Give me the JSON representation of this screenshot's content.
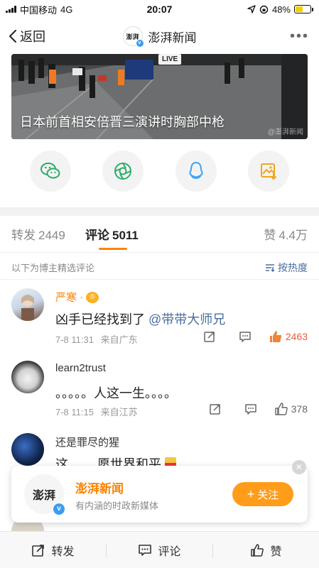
{
  "status": {
    "carrier": "中国移动",
    "network": "4G",
    "time": "20:07",
    "battery": "48%",
    "battery_level": 0.48
  },
  "nav": {
    "back_label": "返回",
    "title": "澎湃新闻",
    "avatar_text": "澎湃"
  },
  "banner": {
    "live_tag": "LIVE",
    "title": "日本前首相安倍晋三演讲时胸部中枪",
    "watermark": "@澎湃新闻"
  },
  "share": {
    "items": [
      {
        "icon": "wechat-icon",
        "color": "#2aae67"
      },
      {
        "icon": "moments-icon",
        "color": "#2aae67"
      },
      {
        "icon": "qq-icon",
        "color": "#3da3f5"
      },
      {
        "icon": "save-image-icon",
        "color": "#f2a516"
      }
    ]
  },
  "tabs": {
    "repost_label": "转发",
    "repost_count": "2449",
    "comment_label": "评论",
    "comment_count": "5011",
    "like_label": "赞",
    "like_count": "4.4万"
  },
  "filter": {
    "note": "以下为博主精选评论",
    "sort_label": "按热度"
  },
  "comments": [
    {
      "name": "严寒",
      "name_suffix": "·",
      "name_color": "#ff8200",
      "text": "凶手已经找到了",
      "mention": "@带带大师兄",
      "time": "7-8 11:31",
      "location": "来自广东",
      "likes": "2463",
      "liked": true
    },
    {
      "name": "learn2trust",
      "name_color": "#333333",
      "text": "。。。。。人这一生。。。。",
      "time": "7-8 11:15",
      "location": "来自江苏",
      "likes": "378",
      "liked": false
    },
    {
      "name": "还是罪尽的猩",
      "name_color": "#333333",
      "text": "这…… 愿世界和平"
    }
  ],
  "follow_card": {
    "name": "澎湃新闻",
    "desc": "有内涵的时政新媒体",
    "button": "关注",
    "avatar_text": "澎湃"
  },
  "bottom": {
    "repost": "转发",
    "comment": "评论",
    "like": "赞"
  },
  "colors": {
    "accent": "#ff8200",
    "link": "#4a6ea0"
  }
}
